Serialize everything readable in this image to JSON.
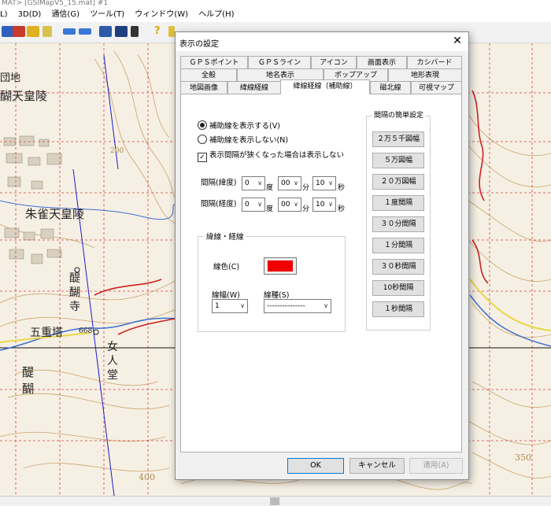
{
  "app": {
    "title_fragment": "MAT> [GSIMapV5_15.mat] #1",
    "menu": [
      "L)",
      "3D(D)",
      "通信(G)",
      "ツール(T)",
      "ウィンドウ(W)",
      "ヘルプ(H)"
    ]
  },
  "map_labels": {
    "label1": "団地",
    "label2": "醐天皇陵",
    "label3": "朱雀天皇陵",
    "label4": "醍",
    "label5": "醐",
    "label6": "寺",
    "label7": "五重塔",
    "label8": "女",
    "label9": "人",
    "label10": "堂",
    "label11": "醍",
    "label12": "醐",
    "label13": "668",
    "label14": "350",
    "label15": "400",
    "label16": "200"
  },
  "dialog": {
    "title": "表示の設定",
    "close_glyph": "✕",
    "tabs_row1": [
      "ＧＰＳポイント",
      "ＧＰＳライン",
      "アイコン",
      "画面表示",
      "カシバード"
    ],
    "tabs_row2": [
      "全般",
      "地名表示",
      "ポップアップ",
      "地形表現"
    ],
    "tabs_row3": [
      "地図画像",
      "緯線経線",
      "緯線経線（補助線）",
      "磁北線",
      "可視マップ"
    ],
    "active_tab": "緯線経線（補助線）",
    "show_aux": "補助線を表示する(V)",
    "hide_aux": "補助線を表示しない(N)",
    "hide_narrow": "表示間隔が狭くなった場合は表示しない",
    "check_glyph": "✓",
    "interval_lat": {
      "label": "間隔(緯度)",
      "deg": "0",
      "min": "00",
      "sec": "10"
    },
    "interval_lon": {
      "label": "間隔(経度)",
      "deg": "0",
      "min": "00",
      "sec": "10"
    },
    "unit_deg": "度",
    "unit_min": "分",
    "unit_sec": "秒",
    "line_group": "緯線・経線",
    "line_color_label": "線色(C)",
    "line_color": "#ee0000",
    "line_width_label": "線幅(W)",
    "line_width": "1",
    "line_style_label": "線種(S)",
    "line_style": "---------------",
    "quick_title": "間隔の簡単設定",
    "quick_buttons": [
      "２万５千図幅",
      "５万図幅",
      "２０万図幅",
      "１度間隔",
      "３０分間隔",
      "１分間隔",
      "３０秒間隔",
      "10秒間隔",
      "１秒間隔"
    ],
    "ok": "OK",
    "cancel": "キャンセル",
    "apply": "適用(A)"
  },
  "colors": {
    "road": "#cc2222",
    "river": "#3a6fd0",
    "contour": "#caa36e",
    "grid": "#d44040",
    "aux_line": "#1a1ac8"
  }
}
